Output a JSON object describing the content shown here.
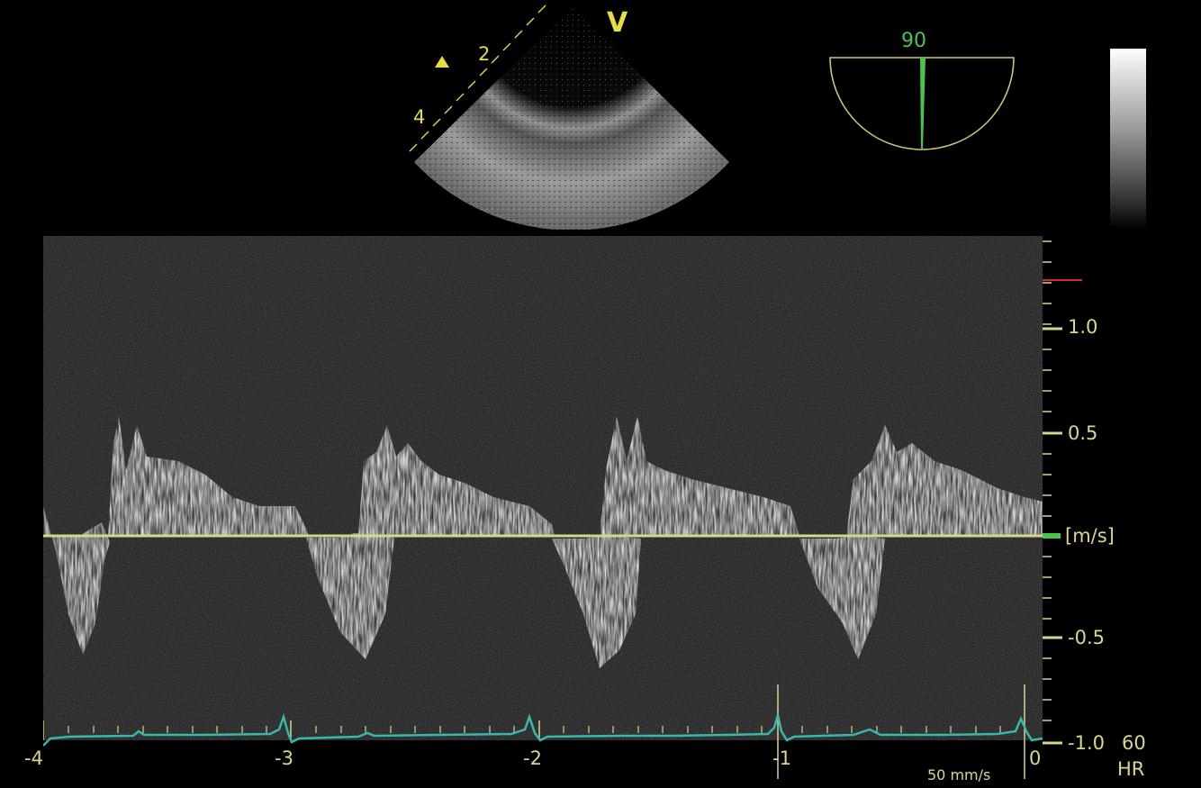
{
  "image": {
    "probe_marker": "V",
    "depth_labels": [
      "2",
      "4"
    ],
    "angle_value": "90",
    "velocity_labels": {
      "v1": "1.0",
      "v05": "0.5",
      "unit": "[m/s]",
      "vm05": "-0.5",
      "vm1": "-1.0"
    },
    "heart_rate": "60",
    "heart_rate_label": "HR",
    "sweep_speed": "50 mm/s",
    "time_labels": [
      "-4",
      "-3",
      "-2",
      "-1",
      "0"
    ],
    "colors": {
      "baseline": "#d6d58a",
      "ecg": "#37b8a8",
      "angle": "#4ec24e",
      "annotation": "#e6df3a"
    }
  }
}
